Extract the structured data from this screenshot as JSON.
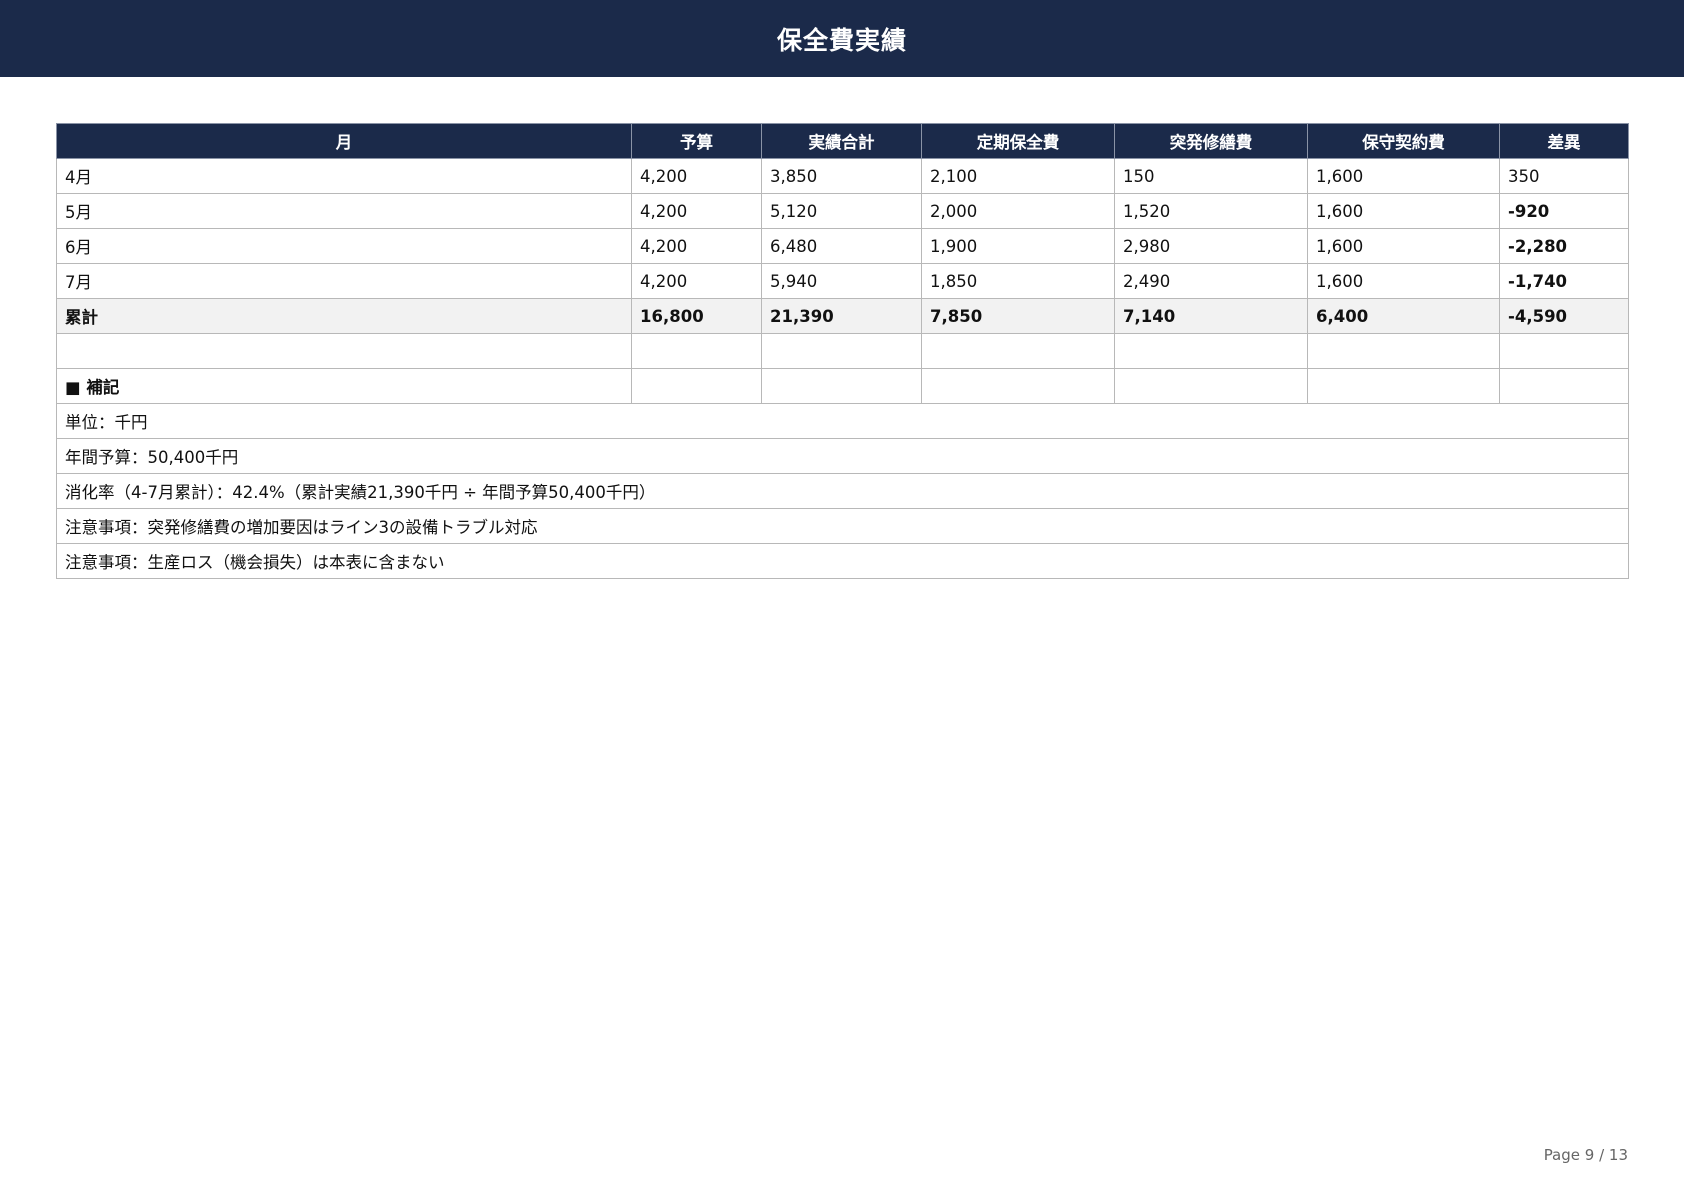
{
  "title": "保全費実績",
  "table": {
    "headers": [
      "月",
      "予算",
      "実績合計",
      "定期保全費",
      "突発修繕費",
      "保守契約費",
      "差異"
    ],
    "rows": [
      [
        "4月",
        "4,200",
        "3,850",
        "2,100",
        "150",
        "1,600",
        "350"
      ],
      [
        "5月",
        "4,200",
        "5,120",
        "2,000",
        "1,520",
        "1,600",
        "-920"
      ],
      [
        "6月",
        "4,200",
        "6,480",
        "1,900",
        "2,980",
        "1,600",
        "-2,280"
      ],
      [
        "7月",
        "4,200",
        "5,940",
        "1,850",
        "2,490",
        "1,600",
        "-1,740"
      ]
    ],
    "total": [
      "累計",
      "16,800",
      "21,390",
      "7,850",
      "7,140",
      "6,400",
      "-4,590"
    ]
  },
  "notes": {
    "heading": "■ 補記",
    "lines": [
      "単位：千円",
      "年間予算：50,400千円",
      "消化率（4-7月累計）：42.4%（累計実績21,390千円 ÷ 年間予算50,400千円）",
      "注意事項：突発修繕費の増加要因はライン3の設備トラブル対応",
      "注意事項：生産ロス（機会損失）は本表に含まない"
    ]
  },
  "footer": {
    "page_label": "Page 9 / 13"
  }
}
